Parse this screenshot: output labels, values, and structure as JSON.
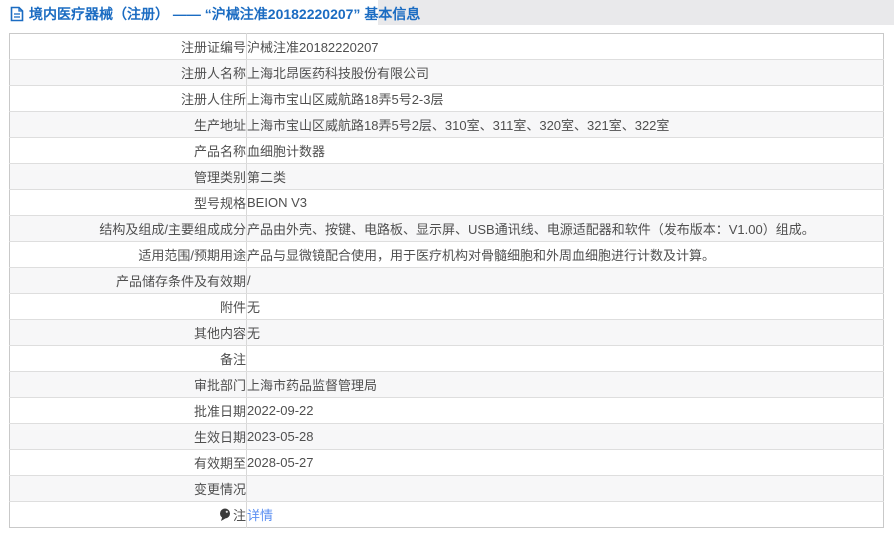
{
  "header": {
    "title": "境内医疗器械（注册） —— “沪械注准20182220207” 基本信息",
    "title_color": "#1b6cc2",
    "band_color": "#e9e9eb",
    "icon": "document-icon"
  },
  "table": {
    "stripe_color": "#f7f7f8",
    "border_color": "#c9c9c9",
    "rows": [
      {
        "label": "注册证编号",
        "value": "沪械注准20182220207"
      },
      {
        "label": "注册人名称",
        "value": "上海北昂医药科技股份有限公司"
      },
      {
        "label": "注册人住所",
        "value": "上海市宝山区威航路18弄5号2-3层"
      },
      {
        "label": "生产地址",
        "value": "上海市宝山区威航路18弄5号2层、310室、311室、320室、321室、322室"
      },
      {
        "label": "产品名称",
        "value": "血细胞计数器"
      },
      {
        "label": "管理类别",
        "value": "第二类"
      },
      {
        "label": "型号规格",
        "value": "BEION V3"
      },
      {
        "label": "结构及组成/主要组成成分",
        "value": "产品由外壳、按键、电路板、显示屏、USB通讯线、电源适配器和软件（发布版本：V1.00）组成。"
      },
      {
        "label": "适用范围/预期用途",
        "value": "产品与显微镜配合使用，用于医疗机构对骨髓细胞和外周血细胞进行计数及计算。"
      },
      {
        "label": "产品储存条件及有效期",
        "value": "/"
      },
      {
        "label": "附件",
        "value": "无"
      },
      {
        "label": "其他内容",
        "value": "无"
      },
      {
        "label": "备注",
        "value": ""
      },
      {
        "label": "审批部门",
        "value": "上海市药品监督管理局"
      },
      {
        "label": "批准日期",
        "value": "2022-09-22"
      },
      {
        "label": "生效日期",
        "value": "2023-05-28"
      },
      {
        "label": "有效期至",
        "value": "2028-05-27"
      },
      {
        "label": "变更情况",
        "value": ""
      },
      {
        "label": "注",
        "value": "详情",
        "value_is_link": true,
        "icon": "note-balloon-icon",
        "link_color": "#5b8ff2"
      }
    ]
  }
}
